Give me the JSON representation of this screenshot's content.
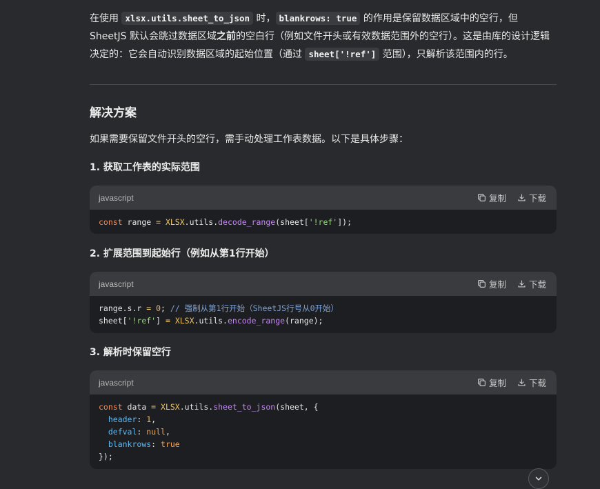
{
  "intro": {
    "t1": "在使用 ",
    "code1": "xlsx.utils.sheet_to_json",
    "t2": " 时，",
    "code2": "blankrows: true",
    "t3": " 的作用是保留数据区域中的空行，但 SheetJS 默认会跳过数据区域",
    "t3_bold": "之前",
    "t4": "的空白行（例如文件开头或有效数据范围外的空行）。这是由库的设计逻辑决定的：它会自动识别数据区域的起始位置（通过 ",
    "code3": "sheet['!ref']",
    "t5": " 范围），只解析该范围内的行。"
  },
  "section": {
    "title": "解决方案",
    "lead": "如果需要保留文件开头的空行，需手动处理工作表数据。以下是具体步骤："
  },
  "steps": [
    {
      "heading": "1. 获取工作表的实际范围"
    },
    {
      "heading": "2. 扩展范围到起始行（例如从第1行开始）"
    },
    {
      "heading": "3. 解析时保留空行"
    }
  ],
  "code_blocks": [
    {
      "language": "javascript",
      "copy_label": "复制",
      "download_label": "下载"
    },
    {
      "language": "javascript",
      "copy_label": "复制",
      "download_label": "下载"
    },
    {
      "language": "javascript",
      "copy_label": "复制",
      "download_label": "下载"
    }
  ],
  "code_tokens": {
    "b1": {
      "const": "const",
      "range": " range ",
      "eq": "=",
      "xlsx": " XLSX",
      "utils": ".utils.",
      "decode": "decode_range",
      "open": "(sheet[",
      "ref": "'!ref'",
      "close": "]);"
    },
    "b2": {
      "l1a": "range.s.r ",
      "eq1": "=",
      "zero": " 0",
      "semi": ";",
      "cm": " // 强制从第1行开始（SheetJS行号从0开始）",
      "l2a": "sheet[",
      "ref": "'!ref'",
      "l2b": "] ",
      "eq2": "=",
      "xlsx": " XLSX",
      "utils": ".utils.",
      "encode": "encode_range",
      "l2c": "(range);"
    },
    "b3": {
      "const": "const",
      "data": " data ",
      "eq": "=",
      "xlsx": " XLSX",
      "utils": ".utils.",
      "fn": "sheet_to_json",
      "open": "(sheet, {",
      "header": "header",
      "one": " 1",
      "defval": "defval",
      "null": " null",
      "blankrows": "blankrows",
      "true": " true",
      "end": "});"
    }
  },
  "icons": {
    "copy": "copy-icon",
    "download": "download-icon",
    "scroll": "chevron-down-icon"
  },
  "colors": {
    "background": "#292a2d",
    "code_bg": "#1d1e21",
    "code_header_bg": "#3a3b3f"
  }
}
